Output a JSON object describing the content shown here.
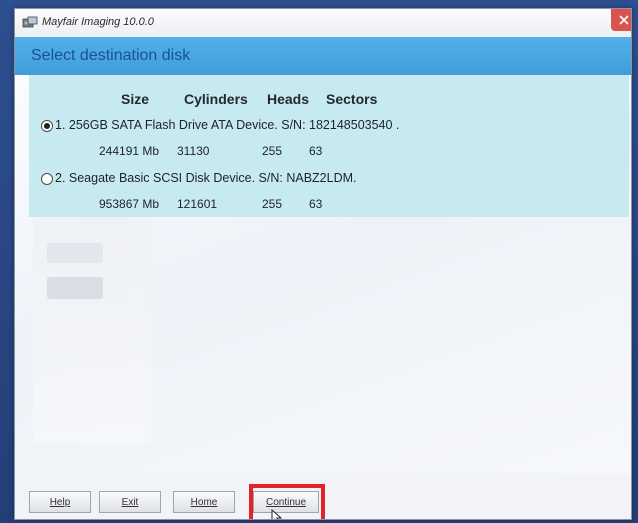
{
  "window": {
    "title": "Mayfair Imaging 10.0.0"
  },
  "banner": {
    "heading": "Select destination disk"
  },
  "columns": {
    "size": "Size",
    "cylinders": "Cylinders",
    "heads": "Heads",
    "sectors": "Sectors"
  },
  "disks": [
    {
      "label": "1. 256GB SATA Flash Drive ATA Device. S/N: 182148503540 .",
      "selected": true,
      "size": "244191 Mb",
      "cylinders": "31130",
      "heads": "255",
      "sectors": "63"
    },
    {
      "label": "2. Seagate Basic SCSI Disk Device. S/N: NABZ2LDM.",
      "selected": false,
      "size": "953867 Mb",
      "cylinders": "121601",
      "heads": "255",
      "sectors": "63"
    }
  ],
  "buttons": {
    "help": "Help",
    "exit": "Exit",
    "home": "Home",
    "continue": "Continue"
  },
  "colors": {
    "banner": "#4aa8e3",
    "panel": "#c6eaf0",
    "highlight": "#e3232a"
  }
}
